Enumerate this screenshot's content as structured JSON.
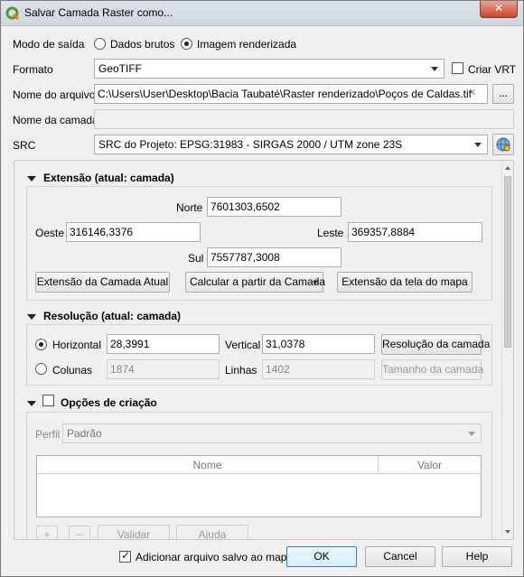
{
  "window": {
    "title": "Salvar Camada Raster como...",
    "close_label": "✕"
  },
  "output_mode": {
    "label": "Modo de saída",
    "option_raw": "Dados brutos",
    "option_rendered": "Imagem renderizada",
    "selected": "Imagem renderizada"
  },
  "format": {
    "label": "Formato",
    "value": "GeoTIFF",
    "create_vrt_label": "Criar VRT"
  },
  "file_name": {
    "label": "Nome do arquivo",
    "value": "C:\\Users\\User\\Desktop\\Bacia Taubaté\\Raster renderizado\\Poços de Caldas.tif",
    "clear_icon": "✕",
    "browse_label": "..."
  },
  "layer_name": {
    "label": "Nome da camada",
    "value": ""
  },
  "crs": {
    "label": "SRC",
    "value": "SRC do Projeto: EPSG:31983 - SIRGAS 2000 / UTM zone 23S",
    "icon": "globe-crs-icon"
  },
  "extent": {
    "title": "Extensão (atual: camada)",
    "north_label": "Norte",
    "north": "7601303,6502",
    "west_label": "Oeste",
    "west": "316146,3376",
    "east_label": "Leste",
    "east": "369357,8884",
    "south_label": "Sul",
    "south": "7557787,3008",
    "btn_current_layer": "Extensão da Camada Atual",
    "btn_calc_from_layer": "Calcular a partir da Camada",
    "btn_map_canvas": "Extensão da tela do mapa"
  },
  "resolution": {
    "title": "Resolução (atual: camada)",
    "horizontal_label": "Horizontal",
    "horizontal": "28,3991",
    "vertical_label": "Vertical",
    "vertical": "31,0378",
    "btn_layer_resolution": "Resolução da camada",
    "columns_label": "Colunas",
    "columns": "1874",
    "rows_label": "Linhas",
    "rows": "1402",
    "btn_layer_size": "Tamanho da camada",
    "selected": "Horizontal"
  },
  "creation_options": {
    "title": "Opções de criação",
    "profile_label": "Perfil",
    "profile_value": "Padrão",
    "col_name": "Nome",
    "col_value": "Valor",
    "add_icon": "+",
    "remove_icon": "−",
    "btn_validate": "Validar",
    "btn_help": "Ajuda"
  },
  "footer": {
    "add_saved_label": "Adicionar arquivo salvo ao mapa",
    "ok": "OK",
    "cancel": "Cancel",
    "help": "Help"
  }
}
